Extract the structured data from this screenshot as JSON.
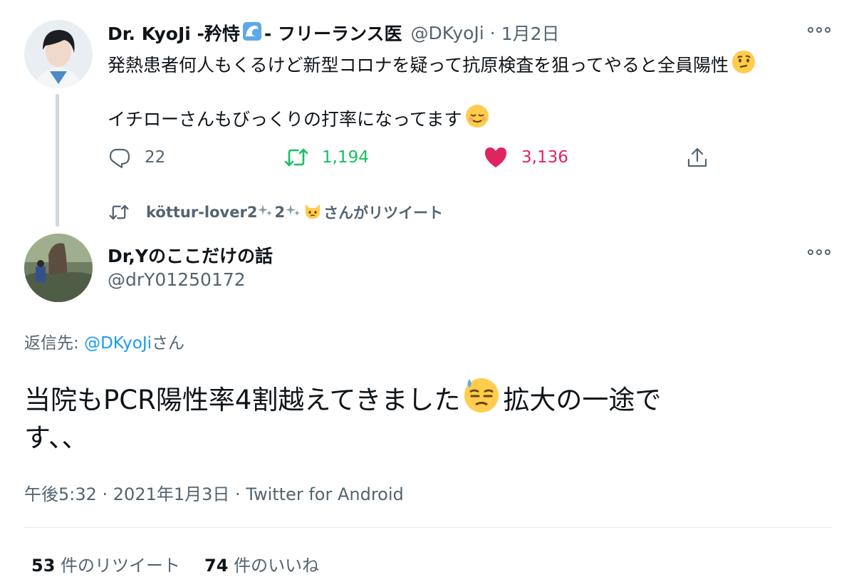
{
  "colors": {
    "retweet_green": "#17bf63",
    "like_red": "#e0245e",
    "muted": "#536471",
    "link_blue": "#1d9bf0"
  },
  "parent_tweet": {
    "display_name": "Dr. KyoJi -矜恃",
    "display_name_suffix": "- フリーランス医",
    "handle": "@DKyoJi",
    "sep": "·",
    "date": "1月2日",
    "line1": "発熱患者何人もくるけど新型コロナを疑って抗原検査を狙ってやると全員陽性",
    "line2": "イチローさんもびっくりの打率になってます",
    "replies": "22",
    "retweets": "1,194",
    "likes": "3,136",
    "icons": [
      "wave-emoji",
      "thinking-face-emoji",
      "relieved-face-emoji",
      "reply-icon",
      "retweet-icon",
      "heart-icon",
      "share-icon",
      "more-icon"
    ]
  },
  "retweet_notice": {
    "user": "köttur-lover2",
    "mid": "2",
    "suffix": "さんがリツイート",
    "icons": [
      "retweet-icon",
      "sparkle-emoji",
      "cat-emoji"
    ]
  },
  "main_tweet": {
    "display_name": "Dr,Yのここだけの話",
    "handle": "@drY01250172",
    "reply_to_label": "返信先: ",
    "reply_to_handle": "@DKyoJi",
    "reply_to_suffix": "さん",
    "text_line1_a": "当院もPCR陽性率4割越えてきました",
    "text_line1_b": "拡大の一途で",
    "text_line2": "す、、",
    "timestamp": "午後5:32 · 2021年1月3日 · Twitter for Android",
    "retweet_count": "53",
    "retweet_label": " 件のリツイート",
    "like_count": "74",
    "like_label": " 件のいいね",
    "icons": [
      "sweat-face-emoji",
      "more-icon"
    ]
  }
}
